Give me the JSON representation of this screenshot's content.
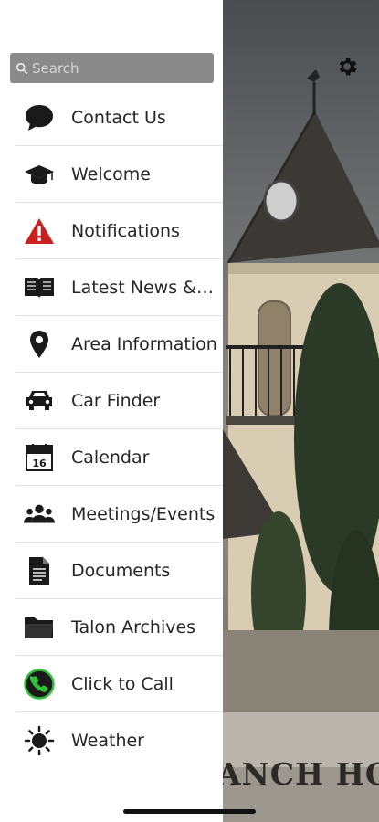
{
  "search": {
    "placeholder": "Search"
  },
  "menu": [
    {
      "label": "Contact Us",
      "icon": "chat-bubble-icon"
    },
    {
      "label": "Welcome",
      "icon": "graduation-cap-icon"
    },
    {
      "label": "Notifications",
      "icon": "warning-icon"
    },
    {
      "label": "Latest News & Events",
      "icon": "open-book-icon"
    },
    {
      "label": "Area Information",
      "icon": "map-pin-icon"
    },
    {
      "label": "Car Finder",
      "icon": "car-icon"
    },
    {
      "label": "Calendar",
      "icon": "calendar-icon",
      "calendar_day": "16"
    },
    {
      "label": "Meetings/Events",
      "icon": "group-icon"
    },
    {
      "label": "Documents",
      "icon": "document-icon"
    },
    {
      "label": "Talon Archives",
      "icon": "folder-icon"
    },
    {
      "label": "Click to Call",
      "icon": "phone-icon"
    },
    {
      "label": "Weather",
      "icon": "sun-icon"
    }
  ],
  "background": {
    "banner_text": "ANCH HOA"
  },
  "colors": {
    "warning": "#cc1f1f",
    "phone_ring": "#2fc13a",
    "search_bg": "#8a8a8a"
  }
}
